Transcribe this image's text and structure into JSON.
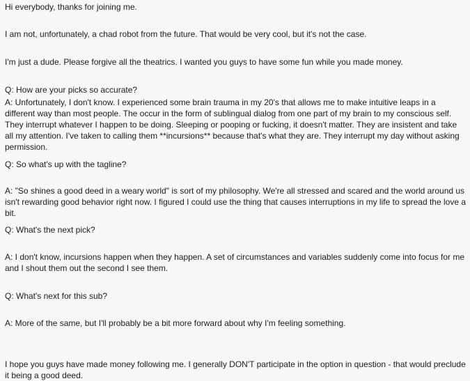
{
  "post": {
    "paragraphs": [
      "Hi everybody, thanks for joining me.",
      "I am not, unfortunately, a chad robot from the future. That would be very cool, but it's not the case.",
      "I'm just a dude. Please forgive all the theatrics. I wanted you guys to have some fun while you made money.",
      "Q: How are your picks so accurate?",
      "A: Unfortunately, I don't know. I experienced some brain trauma in my 20's that allows me to make intuitive leaps in a different way than most people. The occur in the form of sublingual dialog from one part of my brain to my conscious self. They interrupt whatever I happen to be doing. Sleeping or pooping or fucking, it doesn't matter. They are insistent and take all my attention. I've taken to calling them **incursions** because that's what they are. They interrupt my day without asking permission.",
      "Q: So what's up with the tagline?",
      "A: \"So shines a good deed in a weary world\" is sort of my philosophy. We're all stressed and scared and the world around us isn't rewarding good behavior right now. I figured I could use the thing that causes interruptions in my life to spread the love a bit.",
      "Q: What's the next pick?",
      "A: I don't know, incursions happen when they happen. A set of circumstances and variables suddenly come into focus for me and I shout them out the second I see them.",
      "Q: What's next for this sub?",
      "A: More of the same, but I'll probably be a bit more forward about why I'm feeling something.",
      "I hope you guys have made money following me. I generally DON'T participate in the option in question - that would preclude it being a good deed."
    ]
  }
}
